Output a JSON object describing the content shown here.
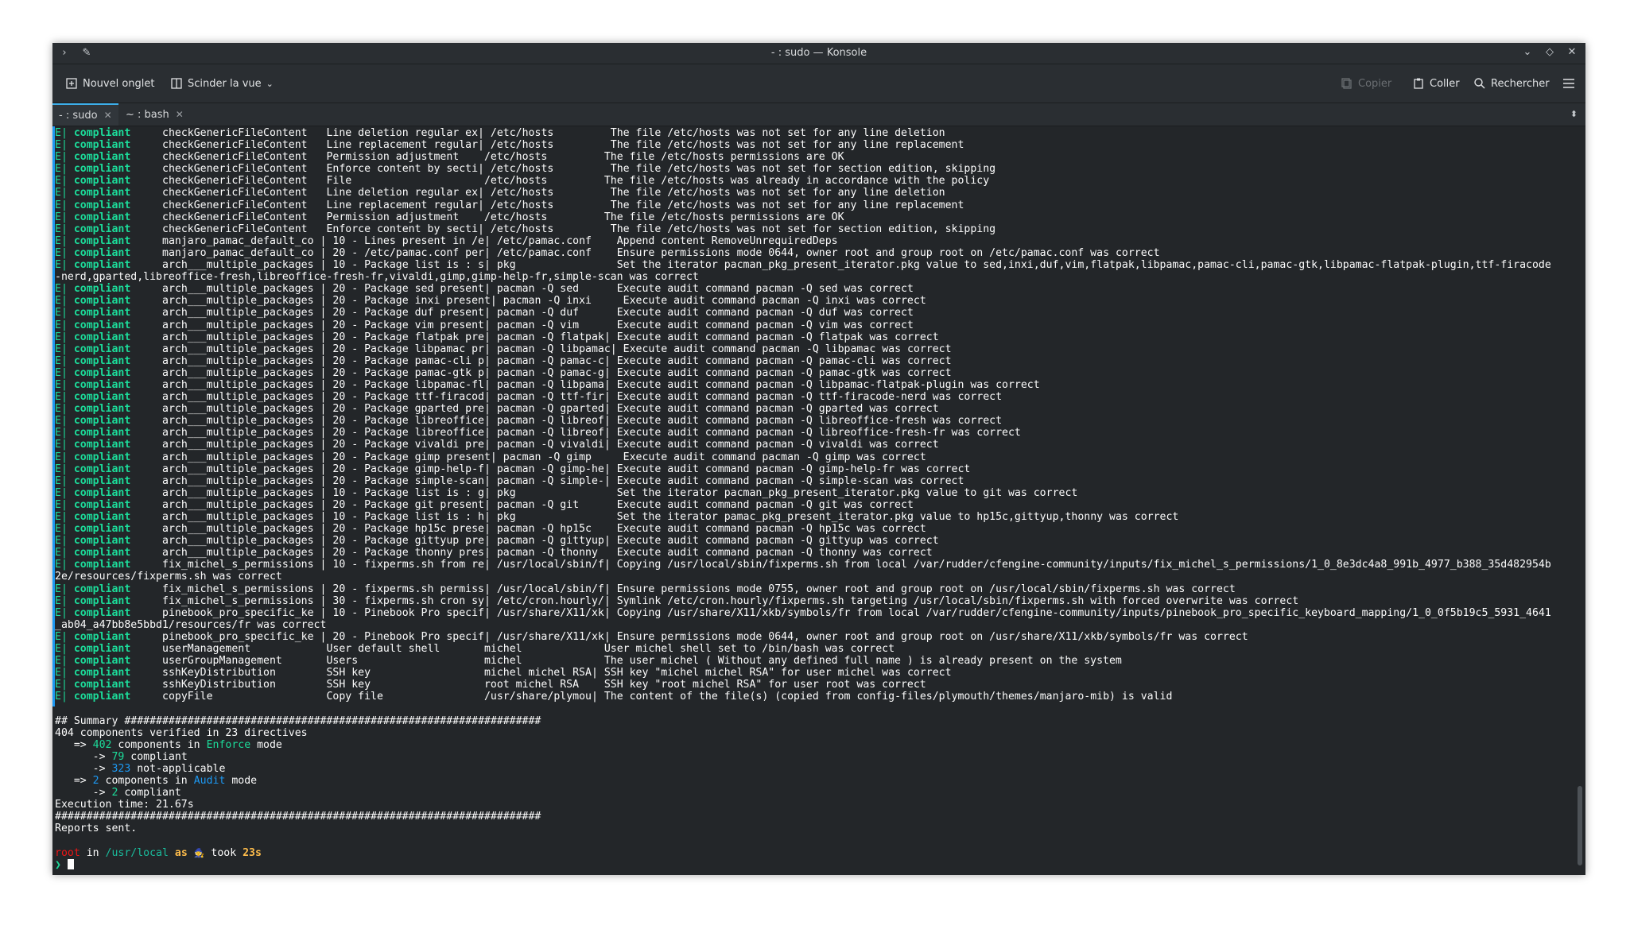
{
  "window": {
    "title": "- : sudo — Konsole"
  },
  "toolbar": {
    "new_tab": "Nouvel onglet",
    "split_view": "Scinder la vue",
    "copy": "Copier",
    "paste": "Coller",
    "search": "Rechercher"
  },
  "tabs": [
    {
      "label": "- : sudo"
    },
    {
      "label": "~ : bash"
    }
  ],
  "colors": {
    "compliant": "#1cdc9a",
    "accent": "#3daee9",
    "mode": "#1d99f3",
    "user": "#ed1515",
    "duration": "#fdbc4b"
  },
  "terminal": {
    "rows": [
      {
        "name": "checkGenericFileContent",
        "id": "Line deletion regular ex",
        "target": "/etc/hosts",
        "message": "The file /etc/hosts was not set for any line deletion"
      },
      {
        "name": "checkGenericFileContent",
        "id": "Line replacement regular",
        "target": "/etc/hosts",
        "message": "The file /etc/hosts was not set for any line replacement"
      },
      {
        "name": "checkGenericFileContent",
        "id": "Permission adjustment",
        "target": "/etc/hosts",
        "message": "The file /etc/hosts permissions are OK"
      },
      {
        "name": "checkGenericFileContent",
        "id": "Enforce content by secti",
        "target": "/etc/hosts",
        "message": "The file /etc/hosts was not set for section edition, skipping"
      },
      {
        "name": "checkGenericFileContent",
        "id": "File",
        "target": "/etc/hosts",
        "message": "The file /etc/hosts was already in accordance with the policy"
      },
      {
        "name": "checkGenericFileContent",
        "id": "Line deletion regular ex",
        "target": "/etc/hosts",
        "message": "The file /etc/hosts was not set for any line deletion"
      },
      {
        "name": "checkGenericFileContent",
        "id": "Line replacement regular",
        "target": "/etc/hosts",
        "message": "The file /etc/hosts was not set for any line replacement"
      },
      {
        "name": "checkGenericFileContent",
        "id": "Permission adjustment",
        "target": "/etc/hosts",
        "message": "The file /etc/hosts permissions are OK"
      },
      {
        "name": "checkGenericFileContent",
        "id": "Enforce content by secti",
        "target": "/etc/hosts",
        "message": "The file /etc/hosts was not set for section edition, skipping"
      },
      {
        "name": "manjaro_pamac_default_co",
        "id": "10 - Lines present in /e",
        "target": "/etc/pamac.conf",
        "message": "Append content RemoveUnrequiredDeps"
      },
      {
        "name": "manjaro_pamac_default_co",
        "id": "20 - /etc/pamac.conf per",
        "target": "/etc/pamac.conf",
        "message": "Ensure permissions mode 0644, owner root and group root on /etc/pamac.conf was correct"
      },
      {
        "name": "arch___multiple_packages",
        "id": "10 - Package list is : s",
        "target": "pkg",
        "message": "Set the iterator pacman_pkg_present_iterator.pkg value to sed,inxi,duf,vim,flatpak,libpamac,pamac-cli,pamac-gtk,libpamac-flatpak-plugin,ttf-firacode",
        "cont": "-nerd,gparted,libreoffice-fresh,libreoffice-fresh-fr,vivaldi,gimp,gimp-help-fr,simple-scan was correct"
      },
      {
        "name": "arch___multiple_packages",
        "id": "20 - Package sed present",
        "target": "pacman -Q sed",
        "message": "Execute audit command pacman -Q sed was correct"
      },
      {
        "name": "arch___multiple_packages",
        "id": "20 - Package inxi present",
        "target": "pacman -Q inxi",
        "message": "Execute audit command pacman -Q inxi was correct"
      },
      {
        "name": "arch___multiple_packages",
        "id": "20 - Package duf present",
        "target": "pacman -Q duf",
        "message": "Execute audit command pacman -Q duf was correct"
      },
      {
        "name": "arch___multiple_packages",
        "id": "20 - Package vim present",
        "target": "pacman -Q vim",
        "message": "Execute audit command pacman -Q vim was correct"
      },
      {
        "name": "arch___multiple_packages",
        "id": "20 - Package flatpak pre",
        "target": "pacman -Q flatpak",
        "message": "Execute audit command pacman -Q flatpak was correct"
      },
      {
        "name": "arch___multiple_packages",
        "id": "20 - Package libpamac pr",
        "target": "pacman -Q libpamac",
        "message": "Execute audit command pacman -Q libpamac was correct"
      },
      {
        "name": "arch___multiple_packages",
        "id": "20 - Package pamac-cli p",
        "target": "pacman -Q pamac-c",
        "message": "Execute audit command pacman -Q pamac-cli was correct"
      },
      {
        "name": "arch___multiple_packages",
        "id": "20 - Package pamac-gtk p",
        "target": "pacman -Q pamac-g",
        "message": "Execute audit command pacman -Q pamac-gtk was correct"
      },
      {
        "name": "arch___multiple_packages",
        "id": "20 - Package libpamac-fl",
        "target": "pacman -Q libpama",
        "message": "Execute audit command pacman -Q libpamac-flatpak-plugin was correct"
      },
      {
        "name": "arch___multiple_packages",
        "id": "20 - Package ttf-firacod",
        "target": "pacman -Q ttf-fir",
        "message": "Execute audit command pacman -Q ttf-firacode-nerd was correct"
      },
      {
        "name": "arch___multiple_packages",
        "id": "20 - Package gparted pre",
        "target": "pacman -Q gparted",
        "message": "Execute audit command pacman -Q gparted was correct"
      },
      {
        "name": "arch___multiple_packages",
        "id": "20 - Package libreoffice",
        "target": "pacman -Q libreof",
        "message": "Execute audit command pacman -Q libreoffice-fresh was correct"
      },
      {
        "name": "arch___multiple_packages",
        "id": "20 - Package libreoffice",
        "target": "pacman -Q libreof",
        "message": "Execute audit command pacman -Q libreoffice-fresh-fr was correct"
      },
      {
        "name": "arch___multiple_packages",
        "id": "20 - Package vivaldi pre",
        "target": "pacman -Q vivaldi",
        "message": "Execute audit command pacman -Q vivaldi was correct"
      },
      {
        "name": "arch___multiple_packages",
        "id": "20 - Package gimp present",
        "target": "pacman -Q gimp",
        "message": "Execute audit command pacman -Q gimp was correct"
      },
      {
        "name": "arch___multiple_packages",
        "id": "20 - Package gimp-help-f",
        "target": "pacman -Q gimp-he",
        "message": "Execute audit command pacman -Q gimp-help-fr was correct"
      },
      {
        "name": "arch___multiple_packages",
        "id": "20 - Package simple-scan",
        "target": "pacman -Q simple-",
        "message": "Execute audit command pacman -Q simple-scan was correct"
      },
      {
        "name": "arch___multiple_packages",
        "id": "10 - Package list is : g",
        "target": "pkg",
        "message": "Set the iterator pacman_pkg_present_iterator.pkg value to git was correct"
      },
      {
        "name": "arch___multiple_packages",
        "id": "20 - Package git present",
        "target": "pacman -Q git",
        "message": "Execute audit command pacman -Q git was correct"
      },
      {
        "name": "arch___multiple_packages",
        "id": "10 - Package list is : h",
        "target": "pkg",
        "message": "Set the iterator pamac_pkg_present_iterator.pkg value to hp15c,gittyup,thonny was correct"
      },
      {
        "name": "arch___multiple_packages",
        "id": "20 - Package hp15c prese",
        "target": "pacman -Q hp15c",
        "message": "Execute audit command pacman -Q hp15c was correct"
      },
      {
        "name": "arch___multiple_packages",
        "id": "20 - Package gittyup pre",
        "target": "pacman -Q gittyup",
        "message": "Execute audit command pacman -Q gittyup was correct"
      },
      {
        "name": "arch___multiple_packages",
        "id": "20 - Package thonny pres",
        "target": "pacman -Q thonny",
        "message": "Execute audit command pacman -Q thonny was correct"
      },
      {
        "name": "fix_michel_s_permissions",
        "id": "10 - fixperms.sh from re",
        "target": "/usr/local/sbin/f",
        "message": "Copying /usr/local/sbin/fixperms.sh from local /var/rudder/cfengine-community/inputs/fix_michel_s_permissions/1_0_8e3dc4a8_991b_4977_b388_35d482954b",
        "cont": "2e/resources/fixperms.sh was correct"
      },
      {
        "name": "fix_michel_s_permissions",
        "id": "20 - fixperms.sh permiss",
        "target": "/usr/local/sbin/f",
        "message": "Ensure permissions mode 0755, owner root and group root on /usr/local/sbin/fixperms.sh was correct"
      },
      {
        "name": "fix_michel_s_permissions",
        "id": "30 - fixperms.sh cron sy",
        "target": "/etc/cron.hourly/",
        "message": "Symlink /etc/cron.hourly/fixperms.sh targeting /usr/local/sbin/fixperms.sh with forced overwrite was correct"
      },
      {
        "name": "pinebook_pro_specific_ke",
        "id": "10 - Pinebook Pro specif",
        "target": "/usr/share/X11/xk",
        "message": "Copying /usr/share/X11/xkb/symbols/fr from local /var/rudder/cfengine-community/inputs/pinebook_pro_specific_keyboard_mapping/1_0_0f5b19c5_5931_4641",
        "cont": "_ab04_a47bb8e5bbd1/resources/fr was correct"
      },
      {
        "name": "pinebook_pro_specific_ke",
        "id": "20 - Pinebook Pro specif",
        "target": "/usr/share/X11/xk",
        "message": "Ensure permissions mode 0644, owner root and group root on /usr/share/X11/xkb/symbols/fr was correct"
      },
      {
        "name": "userManagement",
        "id": "User default shell",
        "target": "michel",
        "message": "User michel shell set to /bin/bash was correct"
      },
      {
        "name": "userGroupManagement",
        "id": "Users",
        "target": "michel",
        "message": "The user michel ( Without any defined full name ) is already present on the system"
      },
      {
        "name": "sshKeyDistribution",
        "id": "SSH key",
        "target": "michel michel RSA",
        "message": "SSH key \"michel michel RSA\" for user michel was correct"
      },
      {
        "name": "sshKeyDistribution",
        "id": "SSH key",
        "target": "root michel RSA",
        "message": "SSH key \"root michel RSA\" for user root was correct"
      },
      {
        "name": "copyFile",
        "id": "Copy file",
        "target": "/usr/share/plymou",
        "message": "The content of the file(s) (copied from config-files/plymouth/themes/manjaro-mib) is valid"
      }
    ],
    "row_prefix": "E|",
    "row_status": "compliant",
    "summary": {
      "header": "## Summary ##################################################################",
      "verified": "404 components verified in 23 directives",
      "enforce_count": "402",
      "enforce_word": "Enforce",
      "enforce_compliant": "79",
      "enforce_na": "323",
      "audit_count": "2",
      "audit_word": "Audit",
      "audit_compliant": "2",
      "exec_time": "Execution time: 21.67s",
      "footer": "#############################################################################",
      "reports": "Reports sent."
    },
    "prompt": {
      "user": "root",
      "dir": "/usr/local",
      "duration": "23s",
      "symbol": "❯"
    }
  }
}
